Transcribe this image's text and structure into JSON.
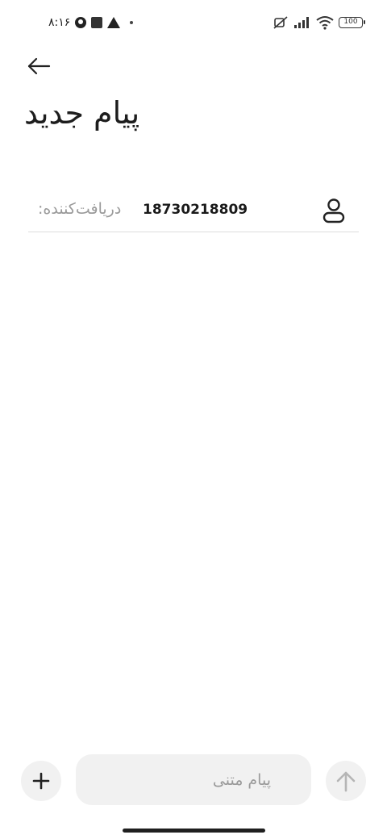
{
  "status_bar": {
    "time": "۸:۱۶",
    "battery": "100",
    "icons": [
      "circle-app-icon",
      "square-app-icon",
      "warning-icon",
      "dot-icon",
      "mute-icon",
      "signal-icon",
      "wifi-icon",
      "battery-icon"
    ]
  },
  "header": {
    "back_icon": "arrow-left-icon",
    "title": "پیام جدید"
  },
  "recipient": {
    "label": "دریافت‌کننده:",
    "number": "18730218809",
    "contact_icon": "person-icon"
  },
  "composer": {
    "add_icon": "plus-icon",
    "placeholder": "پیام متنی",
    "send_icon": "arrow-up-icon"
  },
  "colors": {
    "background": "#ffffff",
    "input_bg": "#f1f1f1",
    "placeholder": "#9a9a9a",
    "divider": "#dcdcdc",
    "send_icon_disabled": "#b5b5b5"
  }
}
